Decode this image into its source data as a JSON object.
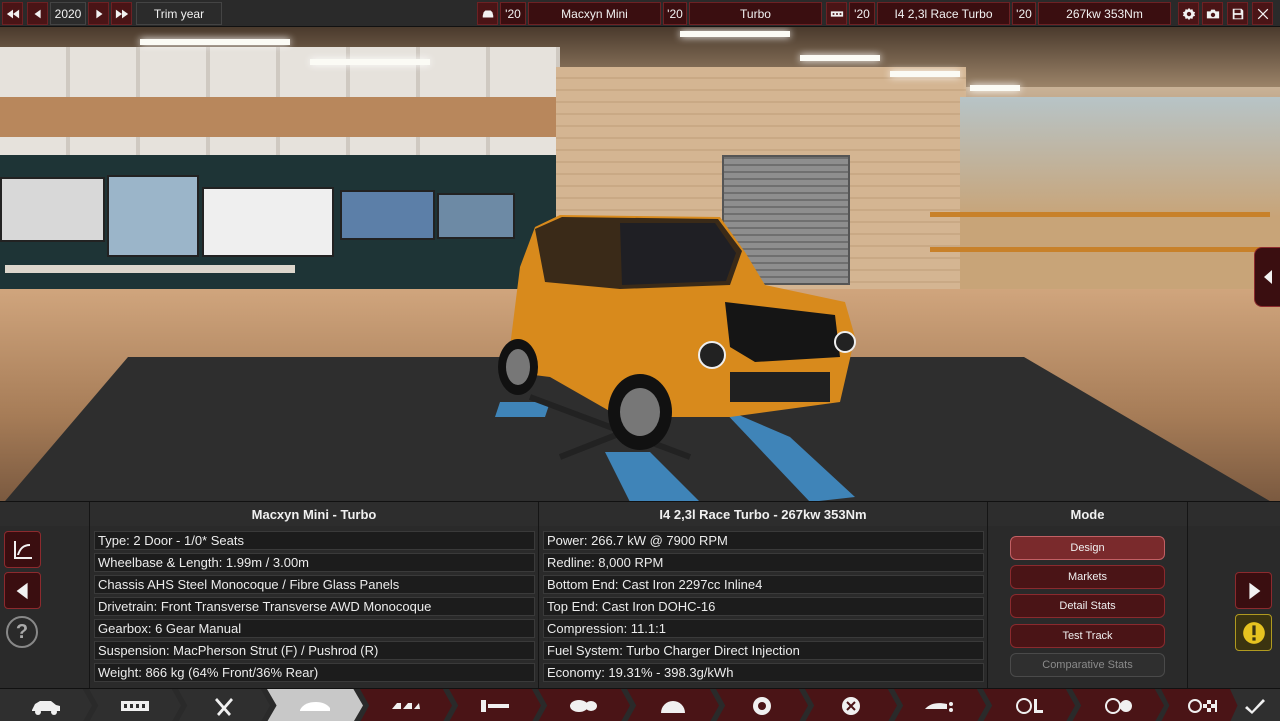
{
  "topbar": {
    "year": "2020",
    "trim_year": "Trim year",
    "model_year": "'20",
    "model_name": "Macxyn Mini",
    "trim_year_short": "'20",
    "trim_name": "Turbo",
    "engine_year": "'20",
    "engine_name": "I4 2,3l Race Turbo",
    "variant_year": "'20",
    "variant_name": "267kw 353Nm"
  },
  "car_panel": {
    "title": "Macxyn Mini - Turbo",
    "rows": [
      "Type: 2 Door - 1/0* Seats",
      "Wheelbase & Length: 1.99m / 3.00m",
      "Chassis AHS Steel Monocoque / Fibre Glass Panels",
      "Drivetrain: Front Transverse Transverse AWD Monocoque",
      "Gearbox: 6 Gear Manual",
      "Suspension: MacPherson Strut (F) / Pushrod (R)",
      "Weight: 866 kg (64% Front/36% Rear)"
    ]
  },
  "engine_panel": {
    "title": "I4 2,3l Race Turbo - 267kw 353Nm",
    "rows": [
      "Power: 266.7 kW @ 7900 RPM",
      "Redline:  8,000 RPM",
      "Bottom End: Cast Iron 2297cc Inline4",
      "Top End: Cast Iron DOHC-16",
      "Compression: 11.1:1",
      "Fuel System: Turbo Charger Direct Injection",
      "Economy: 19.31% - 398.3g/kWh"
    ]
  },
  "mode_panel": {
    "title": "Mode",
    "buttons": [
      "Design",
      "Markets",
      "Detail Stats",
      "Test Track",
      "Comparative Stats"
    ]
  },
  "colors": {
    "accent": "#4a1416",
    "accent_border": "#8d2a2e",
    "panel_bg": "#2a2a2a"
  }
}
